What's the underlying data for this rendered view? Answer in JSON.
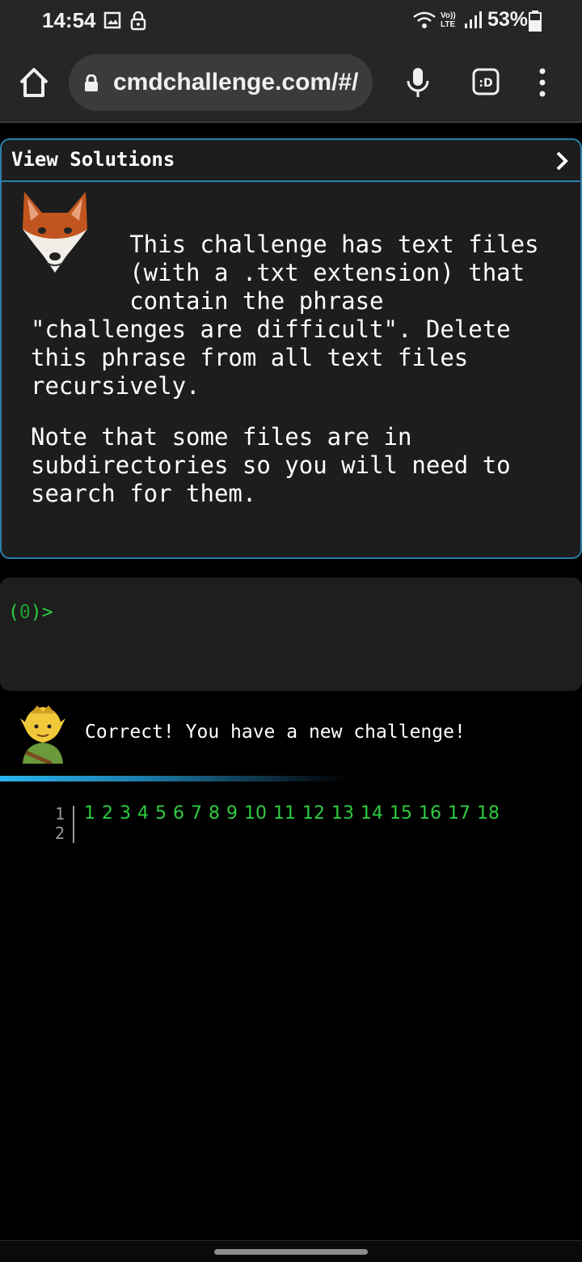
{
  "status_bar": {
    "time": "14:54",
    "network": "Vo)) LTE",
    "battery": "53%"
  },
  "browser": {
    "url": "cmdchallenge.com/#/"
  },
  "challenge": {
    "header": "View Solutions",
    "lines": [
      "       This challenge has text files",
      "       (with a .txt extension) that",
      "       contain the phrase",
      "\"challenges are difficult\". Delete",
      "this phrase from all text files",
      "recursively."
    ],
    "note_lines": [
      "Note that some files are in",
      "subdirectories so you will need to",
      "search for them."
    ]
  },
  "terminal": {
    "prompt_open": "(",
    "prompt_count": "0",
    "prompt_close": ")>"
  },
  "feedback": {
    "message": "Correct! You have a new challenge!"
  },
  "level_nav": {
    "gutter": [
      "1",
      "2"
    ],
    "levels": [
      "1",
      "2",
      "3",
      "4",
      "5",
      "6",
      "7",
      "8",
      "9",
      "10",
      "11",
      "12",
      "13",
      "14",
      "15",
      "16",
      "17",
      "18"
    ]
  },
  "colors": {
    "accent": "#2b7fa8",
    "prompt_green": "#2ecc40",
    "panel_bg": "#1d1d1d"
  }
}
